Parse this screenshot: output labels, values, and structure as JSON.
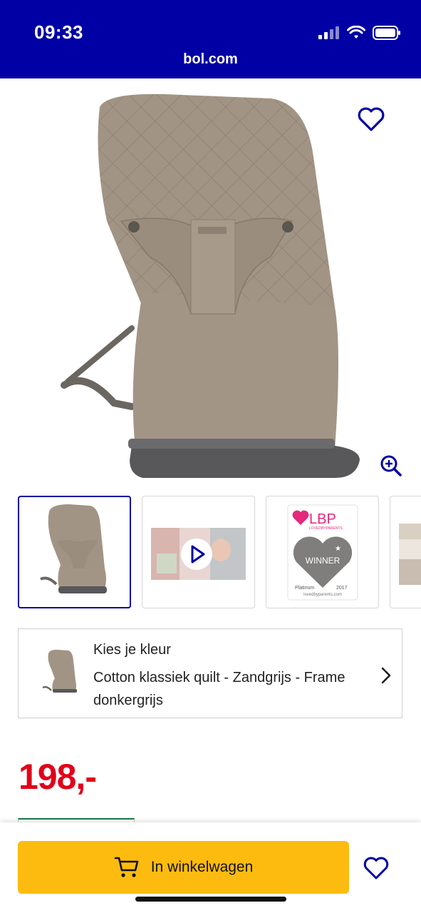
{
  "status_bar": {
    "time": "09:33",
    "url": "bol.com"
  },
  "product": {
    "variant_title": "Kies je kleur",
    "variant_desc": "Cotton klassiek quilt - Zandgrijs - Frame donkergrijs",
    "price": "198,-"
  },
  "thumb_badge": {
    "brand": "LBP",
    "brand_sub": "LOVEDBYPARENTS",
    "award": "WINNER",
    "tier": "Platinum",
    "year": "2017",
    "site": "lovedbyparents.com"
  },
  "actions": {
    "cart_label": "In winkelwagen"
  },
  "colors": {
    "brand_blue": "#0000a4",
    "cart_yellow": "#fdbb10",
    "price_red": "#e0001b"
  }
}
